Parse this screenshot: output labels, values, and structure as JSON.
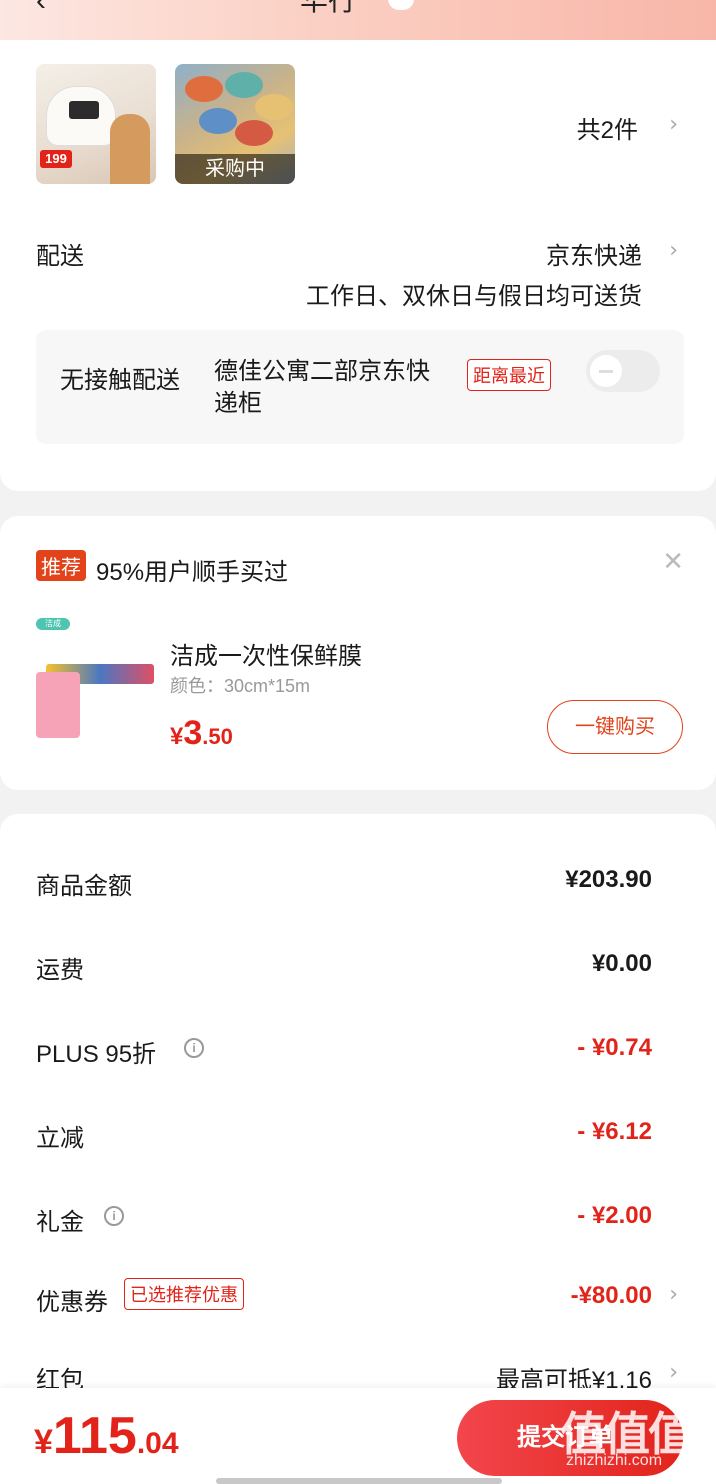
{
  "header": {
    "back_icon": "chevron-left-icon",
    "title": "华行",
    "badge": ""
  },
  "goods": {
    "thumb1_price": "199",
    "thumb2_status": "采购中",
    "count_label": "共2件"
  },
  "shipping": {
    "label": "配送",
    "method": "京东快递",
    "note": "工作日、双休日与假日均可送货",
    "contactless_label": "无接触配送",
    "locker_address": "德佳公寓二部京东快递柜",
    "nearest_badge": "距离最近",
    "toggle_on": false
  },
  "recommendation": {
    "badge": "推荐",
    "title": "95%用户顺手买过",
    "brand_tag": "洁成",
    "product_name": "洁成一次性保鲜膜",
    "spec": "颜色：30cm*15m",
    "price_currency": "¥",
    "price_int": "3",
    "price_dec": ".50",
    "buy_label": "一键购买"
  },
  "summary": {
    "goods_amount_label": "商品金额",
    "goods_amount": "¥203.90",
    "freight_label": "运费",
    "freight": "¥0.00",
    "plus_label": "PLUS 95折",
    "plus_value": "- ¥0.74",
    "instant_label": "立减",
    "instant_value": "- ¥6.12",
    "gift_label": "礼金",
    "gift_value": "- ¥2.00",
    "coupon_label": "优惠券",
    "coupon_tag": "已选推荐优惠",
    "coupon_value": "-¥80.00",
    "redpacket_label": "红包",
    "redpacket_value": "最高可抵¥1.16"
  },
  "footer": {
    "total_currency": "¥",
    "total_int": "115",
    "total_dec": ".04",
    "submit_label": "提交订单",
    "watermark": "值值值",
    "watermark_url": "zhizhizhi.com"
  },
  "colors": {
    "accent": "#e2231a",
    "header_gradient_end": "#f8b6a8"
  }
}
